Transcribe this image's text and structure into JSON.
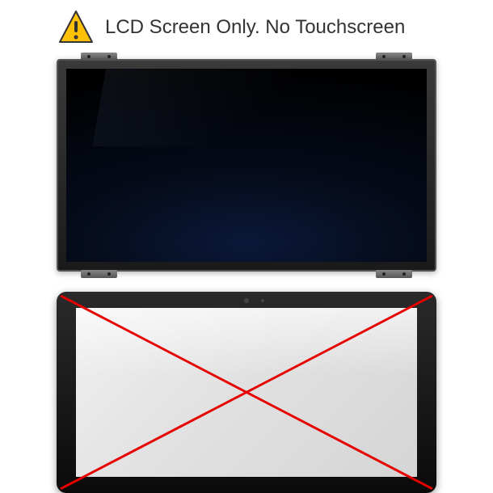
{
  "header": {
    "icon": "warning-triangle",
    "text": "LCD Screen Only. No Touchscreen"
  },
  "colors": {
    "warning_fill": "#FFC107",
    "warning_stroke": "#333333",
    "cross_stroke": "#E60000"
  }
}
